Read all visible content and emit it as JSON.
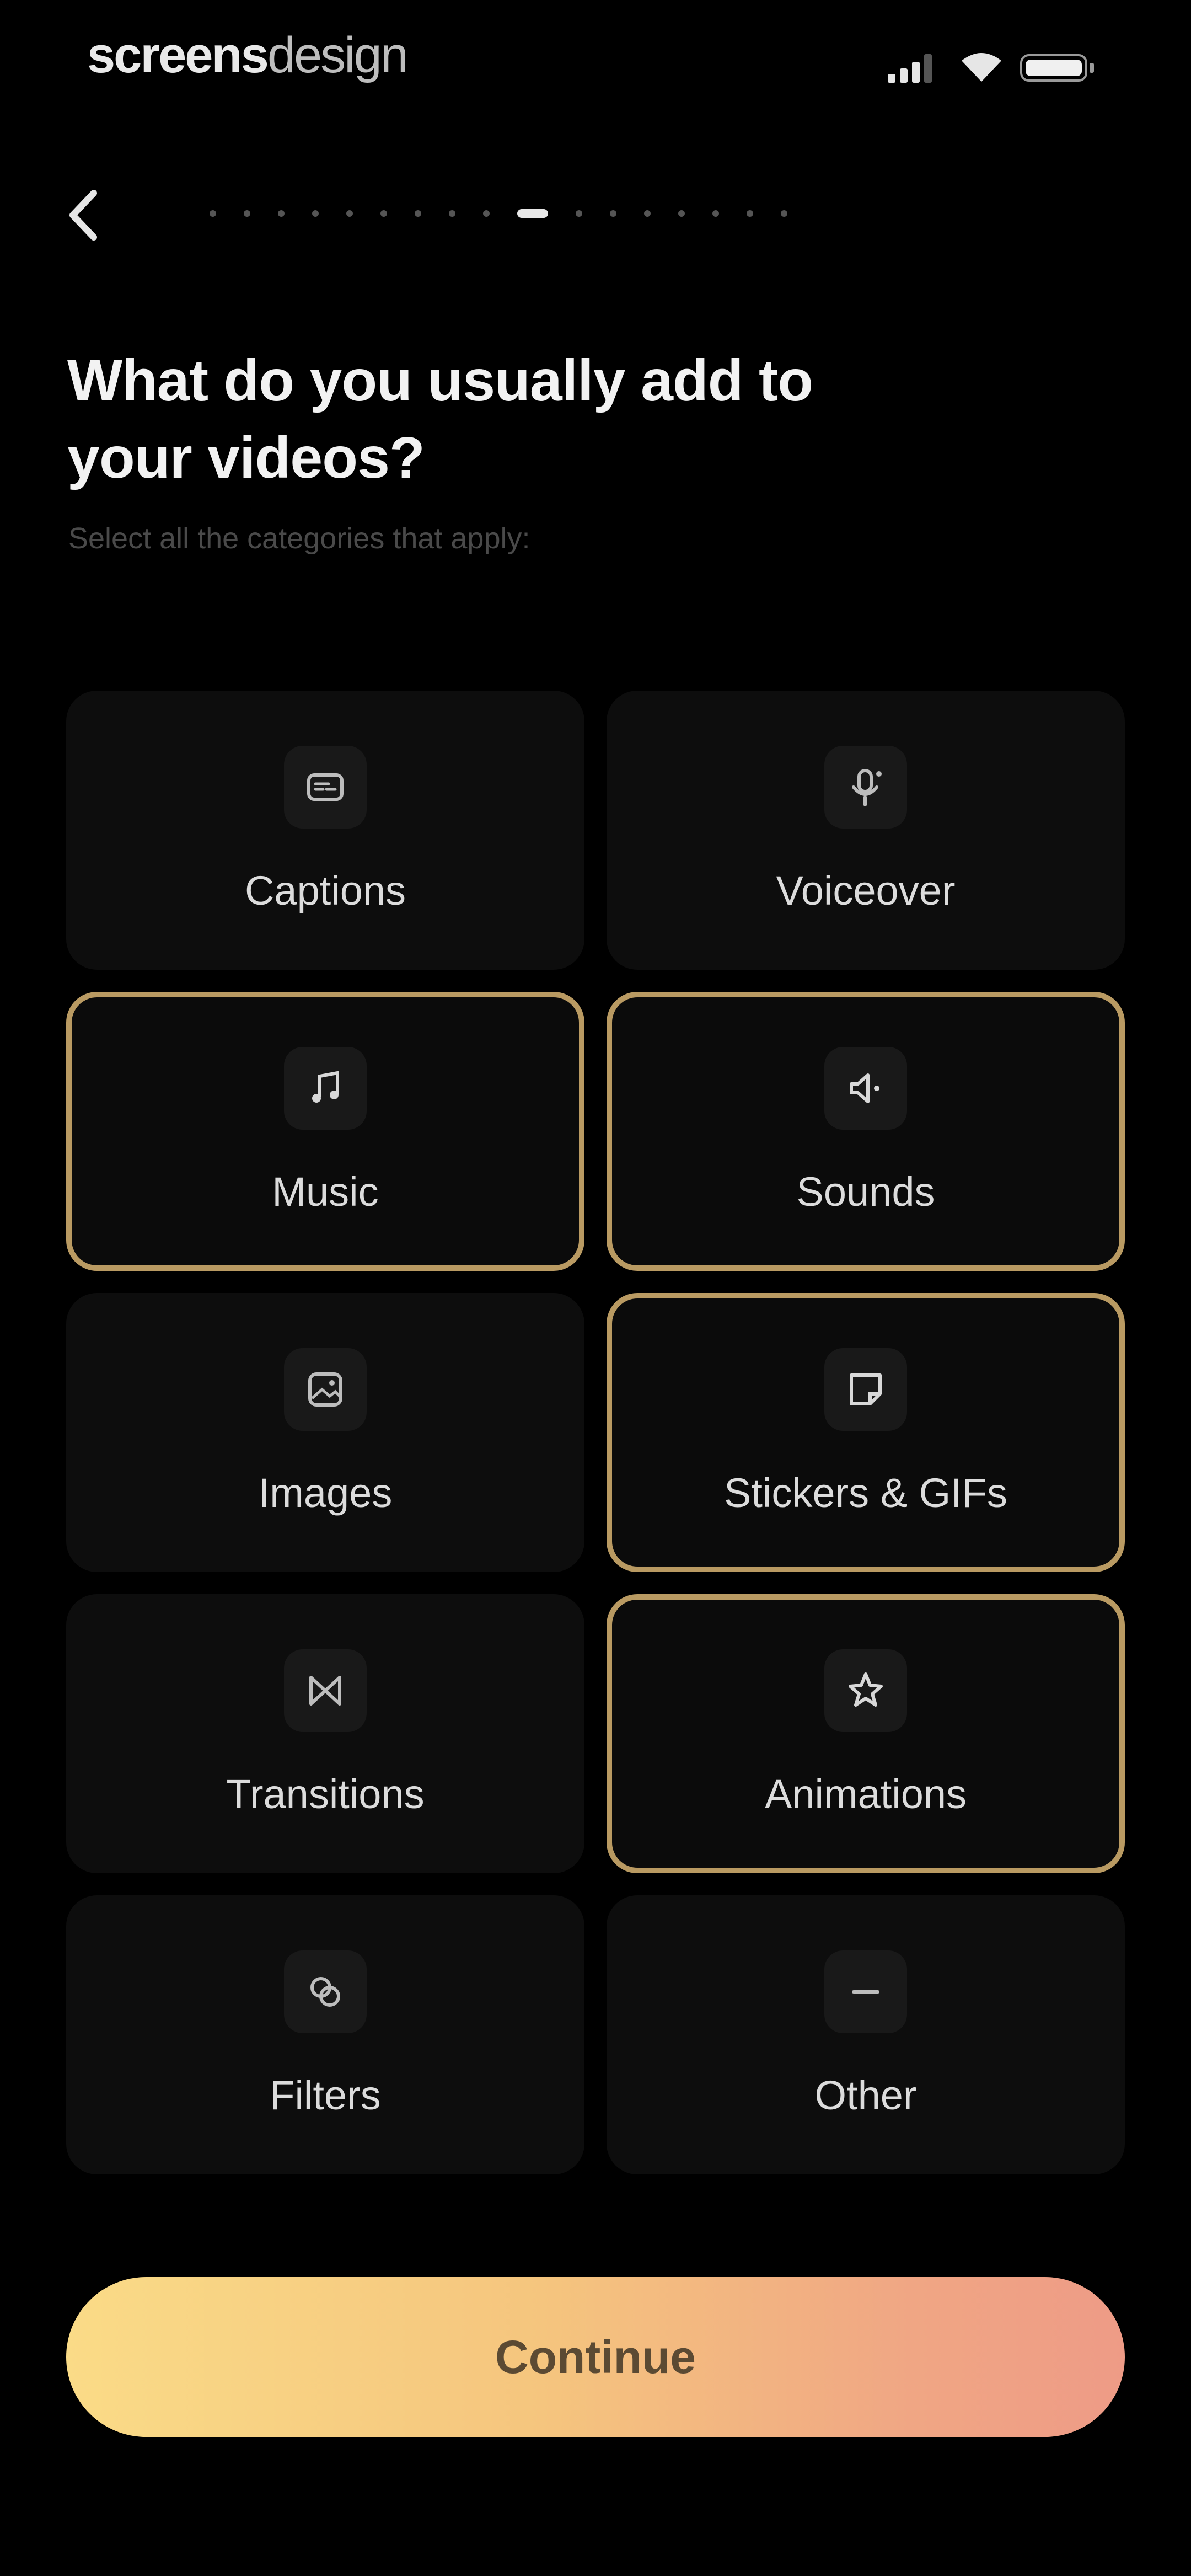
{
  "status_bar": {
    "brand_part1": "screens",
    "brand_part2": "design",
    "icons": [
      "signal-icon",
      "wifi-icon",
      "battery-icon"
    ]
  },
  "nav": {
    "back_icon": "chevron-left-icon",
    "progress": {
      "total_steps": 17,
      "current_step": 10
    }
  },
  "header": {
    "title_line1": "What do you usually add to",
    "title_line2": "your videos?",
    "subtitle": "Select all the categories that apply:"
  },
  "options": [
    {
      "label": "Captions",
      "icon": "captions-icon",
      "selected": false
    },
    {
      "label": "Voiceover",
      "icon": "microphone-icon",
      "selected": false
    },
    {
      "label": "Music",
      "icon": "music-note-icon",
      "selected": true
    },
    {
      "label": "Sounds",
      "icon": "speaker-icon",
      "selected": true
    },
    {
      "label": "Images",
      "icon": "image-icon",
      "selected": false
    },
    {
      "label": "Stickers & GIFs",
      "icon": "sticker-icon",
      "selected": true
    },
    {
      "label": "Transitions",
      "icon": "transition-icon",
      "selected": false
    },
    {
      "label": "Animations",
      "icon": "sparkle-icon",
      "selected": true
    },
    {
      "label": "Filters",
      "icon": "filters-icon",
      "selected": false
    },
    {
      "label": "Other",
      "icon": "dash-icon",
      "selected": false
    }
  ],
  "continue_button": {
    "label": "Continue"
  },
  "colors": {
    "background": "#000000",
    "card": "#0d0d0d",
    "selected_border": "#b99a62",
    "button_gradient_start": "#fadb87",
    "button_gradient_end": "#ee9b86",
    "button_text": "#5b4a33"
  }
}
